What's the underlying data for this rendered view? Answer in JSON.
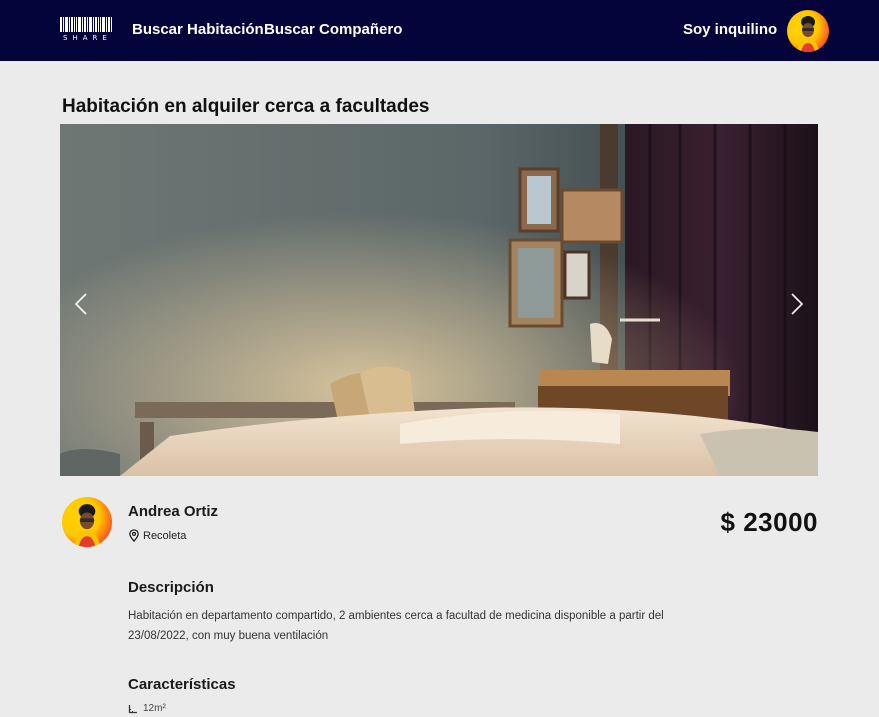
{
  "navbar": {
    "logo_text": "SHARE",
    "links": [
      "Buscar Habitación",
      "Buscar Compañero"
    ],
    "role_label": "Soy inquilino"
  },
  "listing": {
    "title": "Habitación en alquiler cerca a facultades",
    "owner_name": "Andrea Ortiz",
    "location": "Recoleta",
    "price": "$ 23000",
    "description_title": "Descripción",
    "description": "Habitación en departamento compartido, 2 ambientes cerca a facultad de medicina disponible a partir del 23/08/2022, con muy buena ventilación",
    "features_title": "Características",
    "features": [
      {
        "icon": "area-icon",
        "label": "12m²"
      }
    ]
  },
  "colors": {
    "navbar_bg": "#04043a",
    "page_bg": "#ebebeb",
    "avatar_yellow": "#ffc800",
    "avatar_red": "#e9262a"
  }
}
